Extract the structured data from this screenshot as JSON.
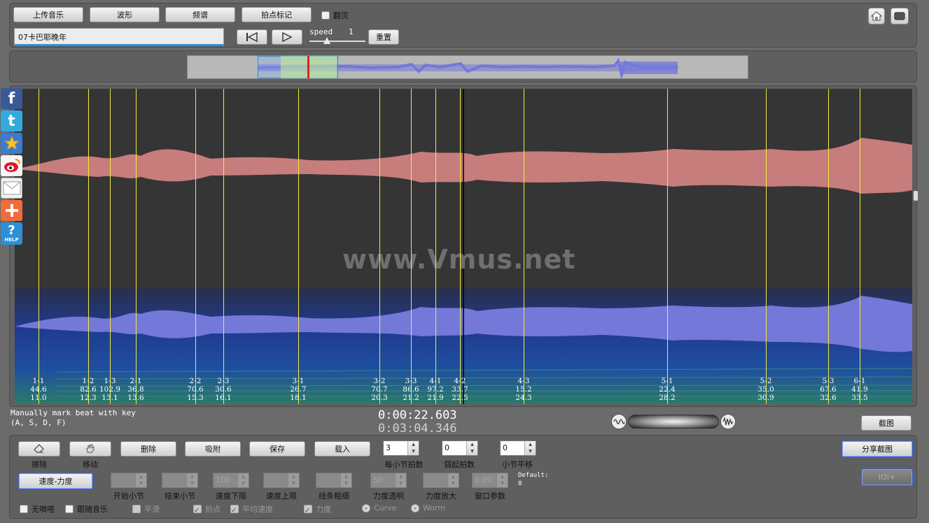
{
  "toolbar": {
    "upload_label": "上传音乐",
    "waveform_label": "波形",
    "spectrum_label": "频谱",
    "beat_mark_label": "拍点标记",
    "page_turn_label": "翻页",
    "file_name": "07卡巴耶晚年",
    "speed_label": "speed",
    "speed_value": "1",
    "reset_label": "重置"
  },
  "main": {
    "watermark": "www.Vmus.net",
    "markers": [
      {
        "label": "1-1",
        "tempo": "44.6",
        "time": "11.0"
      },
      {
        "label": "1-2",
        "tempo": "82.6",
        "time": "12.3"
      },
      {
        "label": "1-3",
        "tempo": "102.9",
        "time": "13.1"
      },
      {
        "label": "2-1",
        "tempo": "36.8",
        "time": "13.6"
      },
      {
        "label": "2-2",
        "tempo": "70.6",
        "time": "15.3"
      },
      {
        "label": "2-3",
        "tempo": "30.6",
        "time": "16.1"
      },
      {
        "label": "3-1",
        "tempo": "26.7",
        "time": "18.1"
      },
      {
        "label": "3-2",
        "tempo": "70.7",
        "time": "20.3"
      },
      {
        "label": "3-3",
        "tempo": "86.6",
        "time": "21.2"
      },
      {
        "label": "4-1",
        "tempo": "97.2",
        "time": "21.9"
      },
      {
        "label": "4-2",
        "tempo": "33.7",
        "time": "22.5"
      },
      {
        "label": "4-3",
        "tempo": "15.2",
        "time": "24.3"
      },
      {
        "label": "5-1",
        "tempo": "22.4",
        "time": "28.2"
      },
      {
        "label": "5-2",
        "tempo": "35.0",
        "time": "30.9"
      },
      {
        "label": "5-3",
        "tempo": "67.6",
        "time": "32.6"
      },
      {
        "label": "6-1",
        "tempo": "41.9",
        "time": "33.5"
      }
    ]
  },
  "status": {
    "hint_line1": "Manually mark beat with key",
    "hint_line2": "(A, S, D, F)",
    "current_time": "0:00:22.603",
    "total_time": "0:03:04.346",
    "screenshot_label": "截图"
  },
  "bottom": {
    "erase_label": "擦除",
    "move_label": "移动",
    "delete_label": "删除",
    "snap_label": "吸附",
    "save_label": "保存",
    "load_label": "载入",
    "beats_per_bar_value": "3",
    "beats_per_bar_label": "每小节拍数",
    "pickup_value": "0",
    "pickup_label": "弱起拍数",
    "bar_shift_value": "0",
    "bar_shift_label": "小节平移",
    "share_label": "分享截图",
    "tempo_force_label": "速度-力度",
    "ioi_label": "IOI+",
    "default_label": "Default:",
    "default_value": "0",
    "params": [
      {
        "label": "开始小节",
        "value": ""
      },
      {
        "label": "结束小节",
        "value": ""
      },
      {
        "label": "速度下限",
        "value": "100"
      },
      {
        "label": "速度上限",
        "value": ""
      },
      {
        "label": "线条粗细",
        "value": ""
      },
      {
        "label": "力度透明",
        "value": "50"
      },
      {
        "label": "力度放大",
        "value": ""
      },
      {
        "label": "窗口参数",
        "value": "0.09"
      }
    ],
    "checks": {
      "no_tick": "无嘀嗒",
      "follow_music": "跟随音乐",
      "smooth": "平滑",
      "beats": "拍点",
      "avg_speed": "平均速度",
      "force": "力度",
      "curve": "Curve",
      "worm": "Worm"
    }
  },
  "social": {
    "facebook": "f",
    "twitter": "t",
    "help": "HELP"
  },
  "colors": {
    "waveform_top": "#c77d7c",
    "waveform_bottom": "#7478d9",
    "marker": "#f2ea3c",
    "spectrum_bg": "#353535"
  }
}
